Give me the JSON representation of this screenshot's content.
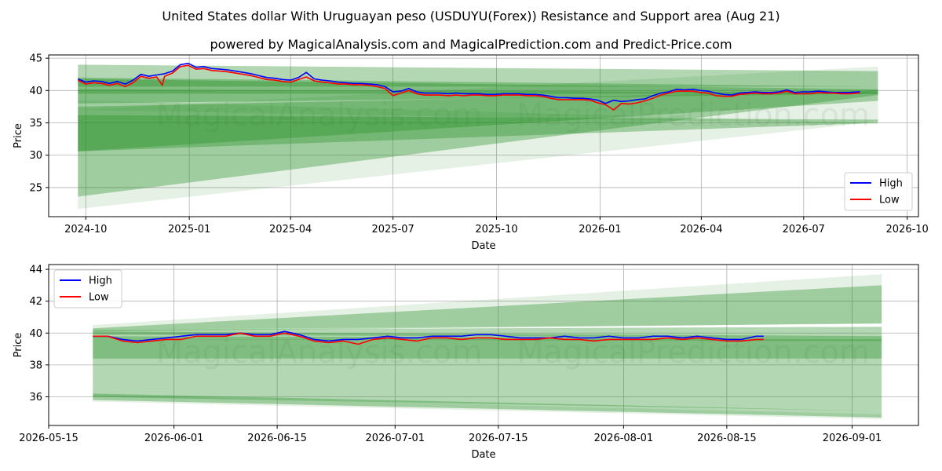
{
  "figure": {
    "title_line1": "United States dollar With Uruguayan peso (USDUYU(Forex)) Resistance and Support area (Aug 21)",
    "title_line2": "powered by MagicalAnalysis.com and MagicalPrediction.com and Predict-Price.com",
    "watermarks": [
      "MagicalAnalysis.com",
      "MagicalPrediction.com"
    ]
  },
  "colors": {
    "high": "#0000ff",
    "low": "#ff0000",
    "band": "#228b22",
    "grid": "#b0b0b0"
  },
  "chart_data": [
    {
      "type": "line",
      "xlabel": "Date",
      "ylabel": "Price",
      "x_type": "date",
      "xlim": [
        "2024-08-29",
        "2026-10-11"
      ],
      "ylim": [
        20.5,
        45.5
      ],
      "x_ticks": [
        "2024-10-01",
        "2025-01-01",
        "2025-04-01",
        "2025-07-01",
        "2025-10-01",
        "2026-01-01",
        "2026-04-01",
        "2026-07-01",
        "2026-10-01"
      ],
      "x_tick_labels": [
        "2024-10",
        "2025-01",
        "2025-04",
        "2025-07",
        "2025-10",
        "2026-01",
        "2026-04",
        "2026-07",
        "2026-10"
      ],
      "y_ticks": [
        25,
        30,
        35,
        40,
        45
      ],
      "grid": true,
      "legend": "lower right",
      "legend_items": [
        "High",
        "Low"
      ],
      "series": [
        {
          "name": "High",
          "x": [
            "2024-09-24",
            "2024-10-01",
            "2024-10-08",
            "2024-10-15",
            "2024-10-22",
            "2024-10-29",
            "2024-11-05",
            "2024-11-12",
            "2024-11-19",
            "2024-11-26",
            "2024-12-03",
            "2024-12-10",
            "2024-12-17",
            "2024-12-24",
            "2024-12-31",
            "2025-01-07",
            "2025-01-14",
            "2025-01-21",
            "2025-01-28",
            "2025-02-04",
            "2025-02-11",
            "2025-02-18",
            "2025-02-25",
            "2025-03-04",
            "2025-03-11",
            "2025-03-18",
            "2025-03-25",
            "2025-04-01",
            "2025-04-08",
            "2025-04-15",
            "2025-04-22",
            "2025-04-29",
            "2025-05-06",
            "2025-05-13",
            "2025-05-20",
            "2025-05-27",
            "2025-06-03",
            "2025-06-10",
            "2025-06-17",
            "2025-06-24",
            "2025-07-01",
            "2025-07-08",
            "2025-07-15",
            "2025-07-22",
            "2025-07-29",
            "2025-08-05",
            "2025-08-12",
            "2025-08-19",
            "2025-08-26",
            "2025-09-02",
            "2025-09-09",
            "2025-09-16",
            "2025-09-23",
            "2025-09-30",
            "2025-10-07",
            "2025-10-14",
            "2025-10-21",
            "2025-10-28",
            "2025-11-04",
            "2025-11-11",
            "2025-11-18",
            "2025-11-25",
            "2025-12-02",
            "2025-12-09",
            "2025-12-16",
            "2025-12-23",
            "2025-12-30",
            "2026-01-06",
            "2026-01-13",
            "2026-01-20",
            "2026-01-27",
            "2026-02-03",
            "2026-02-10",
            "2026-02-17",
            "2026-02-24",
            "2026-03-03",
            "2026-03-10",
            "2026-03-17",
            "2026-03-24",
            "2026-03-31",
            "2026-04-07",
            "2026-04-14",
            "2026-04-21",
            "2026-04-28",
            "2026-05-05",
            "2026-05-12",
            "2026-05-19",
            "2026-05-26",
            "2026-06-02",
            "2026-06-09",
            "2026-06-16",
            "2026-06-23",
            "2026-06-30",
            "2026-07-07",
            "2026-07-14",
            "2026-07-21",
            "2026-07-28",
            "2026-08-04",
            "2026-08-11",
            "2026-08-18",
            "2026-08-20"
          ],
          "values": [
            41.8,
            41.3,
            41.5,
            41.4,
            41.1,
            41.4,
            41.0,
            41.6,
            42.5,
            42.2,
            42.4,
            42.6,
            43.0,
            44.0,
            44.2,
            43.6,
            43.7,
            43.4,
            43.3,
            43.2,
            43.0,
            42.8,
            42.6,
            42.3,
            42.0,
            41.9,
            41.7,
            41.6,
            42.0,
            42.8,
            41.8,
            41.6,
            41.5,
            41.3,
            41.2,
            41.1,
            41.1,
            41.0,
            40.9,
            40.6,
            39.8,
            39.9,
            40.3,
            39.8,
            39.6,
            39.6,
            39.6,
            39.5,
            39.6,
            39.5,
            39.5,
            39.5,
            39.4,
            39.4,
            39.5,
            39.5,
            39.5,
            39.4,
            39.4,
            39.3,
            39.1,
            38.9,
            38.9,
            38.8,
            38.8,
            38.7,
            38.5,
            38.0,
            38.5,
            38.3,
            38.4,
            38.6,
            38.7,
            39.2,
            39.6,
            39.8,
            40.2,
            40.1,
            40.2,
            40.0,
            39.9,
            39.6,
            39.4,
            39.3,
            39.6,
            39.7,
            39.8,
            39.7,
            39.7,
            39.8,
            40.1,
            39.7,
            39.8,
            39.8,
            39.9,
            39.8,
            39.7,
            39.7,
            39.7,
            39.8,
            39.8
          ]
        },
        {
          "name": "Low",
          "x": [
            "2024-09-24",
            "2024-10-01",
            "2024-10-08",
            "2024-10-15",
            "2024-10-22",
            "2024-10-29",
            "2024-11-05",
            "2024-11-12",
            "2024-11-19",
            "2024-11-26",
            "2024-12-03",
            "2024-12-08",
            "2024-12-10",
            "2024-12-17",
            "2024-12-24",
            "2024-12-31",
            "2025-01-07",
            "2025-01-14",
            "2025-01-21",
            "2025-01-28",
            "2025-02-04",
            "2025-02-11",
            "2025-02-18",
            "2025-02-25",
            "2025-03-04",
            "2025-03-11",
            "2025-03-18",
            "2025-03-25",
            "2025-04-01",
            "2025-04-08",
            "2025-04-15",
            "2025-04-22",
            "2025-04-29",
            "2025-05-06",
            "2025-05-13",
            "2025-05-20",
            "2025-05-27",
            "2025-06-03",
            "2025-06-10",
            "2025-06-17",
            "2025-06-24",
            "2025-07-01",
            "2025-07-08",
            "2025-07-15",
            "2025-07-22",
            "2025-07-29",
            "2025-08-05",
            "2025-08-12",
            "2025-08-19",
            "2025-08-26",
            "2025-09-02",
            "2025-09-09",
            "2025-09-16",
            "2025-09-23",
            "2025-09-30",
            "2025-10-07",
            "2025-10-14",
            "2025-10-21",
            "2025-10-28",
            "2025-11-04",
            "2025-11-11",
            "2025-11-18",
            "2025-11-25",
            "2025-12-02",
            "2025-12-09",
            "2025-12-16",
            "2025-12-23",
            "2025-12-30",
            "2026-01-06",
            "2026-01-13",
            "2026-01-20",
            "2026-01-27",
            "2026-02-03",
            "2026-02-10",
            "2026-02-17",
            "2026-02-24",
            "2026-03-03",
            "2026-03-10",
            "2026-03-17",
            "2026-03-24",
            "2026-03-31",
            "2026-04-07",
            "2026-04-14",
            "2026-04-21",
            "2026-04-28",
            "2026-05-05",
            "2026-05-12",
            "2026-05-19",
            "2026-05-26",
            "2026-06-02",
            "2026-06-09",
            "2026-06-16",
            "2026-06-23",
            "2026-06-30",
            "2026-07-07",
            "2026-07-14",
            "2026-07-21",
            "2026-07-28",
            "2026-08-04",
            "2026-08-11",
            "2026-08-18",
            "2026-08-20"
          ],
          "values": [
            41.6,
            41.0,
            41.2,
            41.1,
            40.8,
            41.1,
            40.6,
            41.2,
            42.2,
            41.9,
            42.1,
            40.8,
            42.2,
            42.7,
            43.7,
            43.9,
            43.3,
            43.4,
            43.1,
            43.0,
            42.9,
            42.7,
            42.5,
            42.3,
            42.0,
            41.7,
            41.6,
            41.4,
            41.3,
            41.7,
            42.1,
            41.5,
            41.3,
            41.2,
            41.0,
            41.0,
            40.9,
            40.9,
            40.8,
            40.6,
            40.3,
            39.2,
            39.6,
            40.0,
            39.5,
            39.3,
            39.3,
            39.3,
            39.2,
            39.3,
            39.2,
            39.3,
            39.3,
            39.2,
            39.2,
            39.3,
            39.3,
            39.3,
            39.2,
            39.2,
            39.1,
            38.8,
            38.6,
            38.6,
            38.6,
            38.6,
            38.5,
            38.1,
            37.8,
            37.0,
            38.0,
            37.9,
            38.1,
            38.4,
            38.8,
            39.3,
            39.6,
            39.9,
            39.9,
            39.9,
            39.7,
            39.6,
            39.2,
            39.1,
            39.1,
            39.4,
            39.5,
            39.6,
            39.5,
            39.5,
            39.6,
            39.9,
            39.5,
            39.5,
            39.5,
            39.7,
            39.6,
            39.6,
            39.5,
            39.5,
            39.6,
            39.6
          ]
        }
      ],
      "bands": [
        {
          "start_date": "2024-09-24",
          "end_date": "2026-09-05",
          "start": [
            40.6,
            44.0
          ],
          "end": [
            40.6,
            43.0
          ],
          "opacity": 0.35
        },
        {
          "start_date": "2024-09-24",
          "end_date": "2026-09-05",
          "start": [
            38.0,
            42.0
          ],
          "end": [
            39.5,
            40.6
          ],
          "opacity": 0.35
        },
        {
          "start_date": "2024-09-24",
          "end_date": "2026-09-05",
          "start": [
            39.5,
            41.8
          ],
          "end": [
            39.5,
            40.2
          ],
          "opacity": 0.35
        },
        {
          "start_date": "2024-09-24",
          "end_date": "2026-09-05",
          "start": [
            30.6,
            40.2
          ],
          "end": [
            38.4,
            39.7
          ],
          "opacity": 0.35
        },
        {
          "start_date": "2024-09-24",
          "end_date": "2026-09-05",
          "start": [
            23.6,
            37.5
          ],
          "end": [
            39.3,
            40.0
          ],
          "opacity": 0.35
        },
        {
          "start_date": "2024-09-24",
          "end_date": "2026-09-05",
          "start": [
            30.6,
            36.2
          ],
          "end": [
            35.0,
            35.5
          ],
          "opacity": 0.35
        },
        {
          "start_date": "2024-09-24",
          "end_date": "2026-09-05",
          "start": [
            21.7,
            37.0
          ],
          "end": [
            35.2,
            43.7
          ],
          "opacity": 0.12
        },
        {
          "start_date": "2024-09-24",
          "end_date": "2026-09-05",
          "start": [
            37.0,
            38.5
          ],
          "end": [
            34.8,
            35.0
          ],
          "opacity": 0.12
        }
      ]
    },
    {
      "type": "line",
      "xlabel": "Date",
      "ylabel": "Price",
      "x_type": "date",
      "xlim": [
        "2026-05-15",
        "2026-09-10"
      ],
      "ylim": [
        34.2,
        44.3
      ],
      "x_ticks": [
        "2026-05-15",
        "2026-06-01",
        "2026-06-15",
        "2026-07-01",
        "2026-07-15",
        "2026-08-01",
        "2026-08-15",
        "2026-09-01"
      ],
      "x_tick_labels": [
        "2026-05-15",
        "2026-06-01",
        "2026-06-15",
        "2026-07-01",
        "2026-07-15",
        "2026-08-01",
        "2026-08-15",
        "2026-09-01"
      ],
      "y_ticks": [
        36,
        38,
        40,
        42,
        44
      ],
      "grid": true,
      "legend": "upper left",
      "legend_items": [
        "High",
        "Low"
      ],
      "series": [
        {
          "name": "High",
          "x": [
            "2026-05-21",
            "2026-05-23",
            "2026-05-25",
            "2026-05-27",
            "2026-05-29",
            "2026-05-31",
            "2026-06-02",
            "2026-06-04",
            "2026-06-06",
            "2026-06-08",
            "2026-06-10",
            "2026-06-12",
            "2026-06-14",
            "2026-06-16",
            "2026-06-18",
            "2026-06-20",
            "2026-06-22",
            "2026-06-24",
            "2026-06-26",
            "2026-06-28",
            "2026-06-30",
            "2026-07-02",
            "2026-07-04",
            "2026-07-06",
            "2026-07-08",
            "2026-07-10",
            "2026-07-12",
            "2026-07-14",
            "2026-07-16",
            "2026-07-18",
            "2026-07-20",
            "2026-07-22",
            "2026-07-24",
            "2026-07-26",
            "2026-07-28",
            "2026-07-30",
            "2026-08-01",
            "2026-08-03",
            "2026-08-05",
            "2026-08-07",
            "2026-08-09",
            "2026-08-11",
            "2026-08-13",
            "2026-08-15",
            "2026-08-17",
            "2026-08-19",
            "2026-08-20"
          ],
          "values": [
            39.8,
            39.8,
            39.6,
            39.5,
            39.6,
            39.7,
            39.8,
            39.9,
            39.9,
            39.9,
            40.0,
            39.9,
            39.9,
            40.1,
            39.9,
            39.6,
            39.5,
            39.6,
            39.6,
            39.7,
            39.8,
            39.7,
            39.7,
            39.8,
            39.8,
            39.8,
            39.9,
            39.9,
            39.8,
            39.7,
            39.7,
            39.7,
            39.8,
            39.7,
            39.7,
            39.8,
            39.7,
            39.7,
            39.8,
            39.8,
            39.7,
            39.8,
            39.7,
            39.6,
            39.6,
            39.8,
            39.8
          ]
        },
        {
          "name": "Low",
          "x": [
            "2026-05-21",
            "2026-05-23",
            "2026-05-25",
            "2026-05-27",
            "2026-05-29",
            "2026-05-31",
            "2026-06-02",
            "2026-06-04",
            "2026-06-06",
            "2026-06-08",
            "2026-06-10",
            "2026-06-12",
            "2026-06-14",
            "2026-06-16",
            "2026-06-18",
            "2026-06-20",
            "2026-06-22",
            "2026-06-24",
            "2026-06-26",
            "2026-06-28",
            "2026-06-30",
            "2026-07-02",
            "2026-07-04",
            "2026-07-06",
            "2026-07-08",
            "2026-07-10",
            "2026-07-12",
            "2026-07-14",
            "2026-07-16",
            "2026-07-18",
            "2026-07-20",
            "2026-07-22",
            "2026-07-24",
            "2026-07-26",
            "2026-07-28",
            "2026-07-30",
            "2026-08-01",
            "2026-08-03",
            "2026-08-05",
            "2026-08-07",
            "2026-08-09",
            "2026-08-11",
            "2026-08-13",
            "2026-08-15",
            "2026-08-17",
            "2026-08-19",
            "2026-08-20"
          ],
          "values": [
            39.8,
            39.8,
            39.5,
            39.4,
            39.5,
            39.6,
            39.6,
            39.8,
            39.8,
            39.8,
            40.0,
            39.8,
            39.8,
            40.0,
            39.8,
            39.5,
            39.4,
            39.5,
            39.3,
            39.6,
            39.7,
            39.6,
            39.5,
            39.7,
            39.7,
            39.6,
            39.7,
            39.7,
            39.6,
            39.6,
            39.6,
            39.7,
            39.6,
            39.6,
            39.5,
            39.6,
            39.6,
            39.6,
            39.6,
            39.7,
            39.6,
            39.7,
            39.6,
            39.5,
            39.5,
            39.6,
            39.6
          ]
        }
      ],
      "bands": [
        {
          "start_date": "2026-05-21",
          "end_date": "2026-09-05",
          "start": [
            40.1,
            40.3
          ],
          "end": [
            40.6,
            43.0
          ],
          "opacity": 0.35
        },
        {
          "start_date": "2026-05-21",
          "end_date": "2026-09-05",
          "start": [
            39.9,
            40.2
          ],
          "end": [
            39.7,
            40.4
          ],
          "opacity": 0.35
        },
        {
          "start_date": "2026-05-21",
          "end_date": "2026-09-05",
          "start": [
            39.6,
            40.1
          ],
          "end": [
            39.5,
            39.8
          ],
          "opacity": 0.35
        },
        {
          "start_date": "2026-05-21",
          "end_date": "2026-09-05",
          "start": [
            38.4,
            39.8
          ],
          "end": [
            38.4,
            39.7
          ],
          "opacity": 0.35
        },
        {
          "start_date": "2026-05-21",
          "end_date": "2026-09-05",
          "start": [
            36.0,
            39.6
          ],
          "end": [
            35.1,
            39.6
          ],
          "opacity": 0.35
        },
        {
          "start_date": "2026-05-21",
          "end_date": "2026-09-05",
          "start": [
            35.8,
            36.2
          ],
          "end": [
            34.7,
            35.1
          ],
          "opacity": 0.35
        },
        {
          "start_date": "2026-05-21",
          "end_date": "2026-09-05",
          "start": [
            40.2,
            40.5
          ],
          "end": [
            40.6,
            43.7
          ],
          "opacity": 0.12
        },
        {
          "start_date": "2026-05-21",
          "end_date": "2026-09-05",
          "start": [
            35.7,
            36.1
          ],
          "end": [
            34.6,
            34.9
          ],
          "opacity": 0.12
        }
      ]
    }
  ]
}
